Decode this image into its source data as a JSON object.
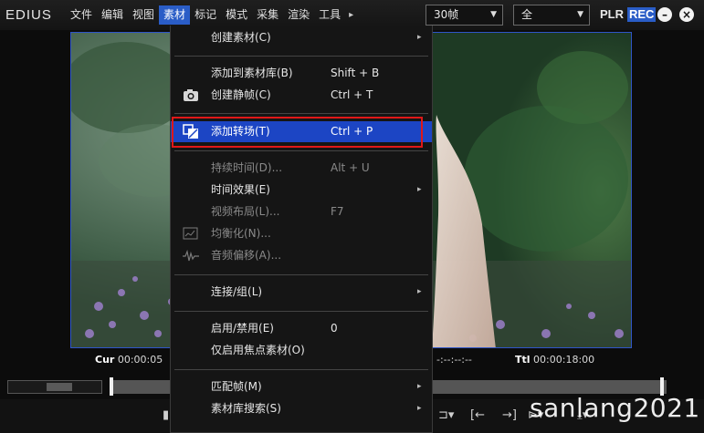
{
  "app": {
    "logo": "EDIUS"
  },
  "menubar": {
    "items": [
      "文件",
      "编辑",
      "视图",
      "素材",
      "标记",
      "模式",
      "采集",
      "渲染",
      "工具"
    ],
    "more": "▸"
  },
  "toolbar": {
    "fps_value": "30帧",
    "mode_value": "全",
    "plr": "PLR",
    "rec": "REC"
  },
  "timecodes": {
    "cur_label": "Cur",
    "cur_value": "00:00:05",
    "mid_value": "-:--:--:--",
    "ttl_label": "Ttl",
    "ttl_value": "00:00:18:00"
  },
  "watermark": "sanlang2021",
  "dropdown": {
    "items": [
      {
        "label": "创建素材(C)",
        "shortcut": "",
        "submenu": "▸"
      },
      {
        "label": "添加到素材库(B)",
        "shortcut": "Shift + B",
        "submenu": ""
      },
      {
        "label": "创建静帧(C)",
        "shortcut": "Ctrl + T",
        "submenu": ""
      },
      {
        "label": "添加转场(T)",
        "shortcut": "Ctrl + P",
        "submenu": ""
      },
      {
        "label": "持续时间(D)...",
        "shortcut": "Alt + U",
        "submenu": ""
      },
      {
        "label": "时间效果(E)",
        "shortcut": "",
        "submenu": "▸"
      },
      {
        "label": "视频布局(L)...",
        "shortcut": "F7",
        "submenu": ""
      },
      {
        "label": "均衡化(N)...",
        "shortcut": "",
        "submenu": ""
      },
      {
        "label": "音频偏移(A)...",
        "shortcut": "",
        "submenu": ""
      },
      {
        "label": "连接/组(L)",
        "shortcut": "",
        "submenu": "▸"
      },
      {
        "label": "启用/禁用(E)",
        "shortcut": "0",
        "submenu": ""
      },
      {
        "label": "仅启用焦点素材(O)",
        "shortcut": "",
        "submenu": ""
      },
      {
        "label": "匹配帧(M)",
        "shortcut": "",
        "submenu": "▸"
      },
      {
        "label": "素材库搜索(S)",
        "shortcut": "",
        "submenu": "▸"
      }
    ]
  },
  "icons": {
    "camera": "camera-icon",
    "transition": "transition-icon",
    "equalize": "equalize-icon",
    "audio_offset": "audio-offset-icon"
  },
  "colors": {
    "accent": "#2a5dc7",
    "highlight": "#1c45c4",
    "annotation": "#e01818"
  }
}
